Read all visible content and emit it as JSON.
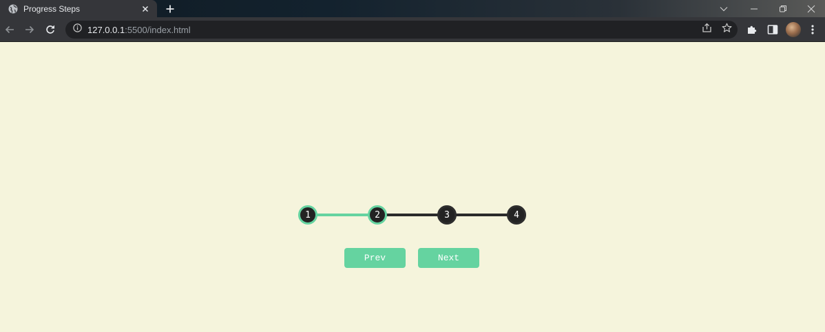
{
  "browser": {
    "tab": {
      "title": "Progress Steps",
      "favicon": "globe-icon"
    },
    "url": {
      "host": "127.0.0.1",
      "path": ":5500/index.html"
    }
  },
  "progress": {
    "steps": [
      "1",
      "2",
      "3",
      "4"
    ],
    "current_step": 2,
    "fill_fraction": 0.3333,
    "colors": {
      "active": "#65d3a0",
      "inactive": "#2b2b2b",
      "circle": "#232323"
    }
  },
  "buttons": {
    "prev": "Prev",
    "next": "Next"
  }
}
